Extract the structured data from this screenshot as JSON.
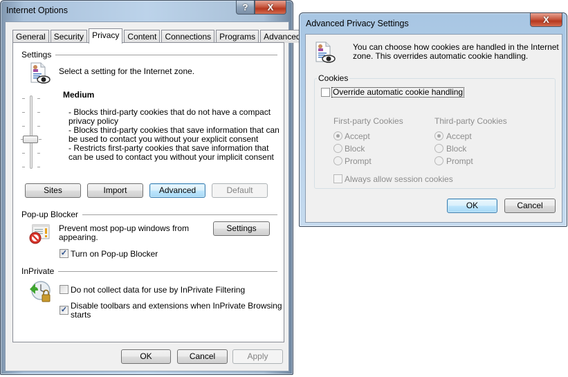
{
  "internet_options": {
    "title": "Internet Options",
    "help_button": "?",
    "close_button": "X",
    "tabs": [
      {
        "label": "General",
        "active": false
      },
      {
        "label": "Security",
        "active": false
      },
      {
        "label": "Privacy",
        "active": true
      },
      {
        "label": "Content",
        "active": false
      },
      {
        "label": "Connections",
        "active": false
      },
      {
        "label": "Programs",
        "active": false
      },
      {
        "label": "Advanced",
        "active": false
      }
    ],
    "settings": {
      "group_label": "Settings",
      "zone_text": "Select a setting for the Internet zone.",
      "level_title": "Medium",
      "level_description": [
        "- Blocks third-party cookies that do not have a compact",
        "privacy policy",
        "- Blocks third-party cookies that save information that can",
        "be used to contact you without your explicit consent",
        "- Restricts first-party cookies that save information that",
        "can be used to contact you without your implicit consent"
      ],
      "slider_level": "Medium",
      "slider_position": "3 of 6",
      "buttons": {
        "sites": "Sites",
        "import": "Import",
        "advanced": "Advanced",
        "default": "Default"
      }
    },
    "popup_blocker": {
      "group_label": "Pop-up Blocker",
      "description_line1": "Prevent most pop-up windows from",
      "description_line2": "appearing.",
      "settings_button": "Settings",
      "turn_on_label": "Turn on Pop-up Blocker",
      "turn_on_checked": true
    },
    "inprivate": {
      "group_label": "InPrivate",
      "no_collect_label": "Do not collect data for use by InPrivate Filtering",
      "no_collect_checked": false,
      "disable_toolbars_line1": "Disable toolbars and extensions when InPrivate Browsing",
      "disable_toolbars_line2": "starts",
      "disable_toolbars_checked": true
    },
    "footer": {
      "ok": "OK",
      "cancel": "Cancel",
      "apply": "Apply"
    }
  },
  "advanced_privacy": {
    "title": "Advanced Privacy Settings",
    "close_button": "X",
    "intro_line1": "You can choose how cookies are handled in the Internet",
    "intro_line2": "zone.  This overrides automatic cookie handling.",
    "cookies_group_label": "Cookies",
    "override_label": "Override automatic cookie handling",
    "override_checked": false,
    "first_party": {
      "header": "First-party Cookies",
      "options": [
        "Accept",
        "Block",
        "Prompt"
      ],
      "selected": "Accept"
    },
    "third_party": {
      "header": "Third-party Cookies",
      "options": [
        "Accept",
        "Block",
        "Prompt"
      ],
      "selected": "Accept"
    },
    "session_label": "Always allow session cookies",
    "session_checked": false,
    "ok": "OK",
    "cancel": "Cancel"
  }
}
